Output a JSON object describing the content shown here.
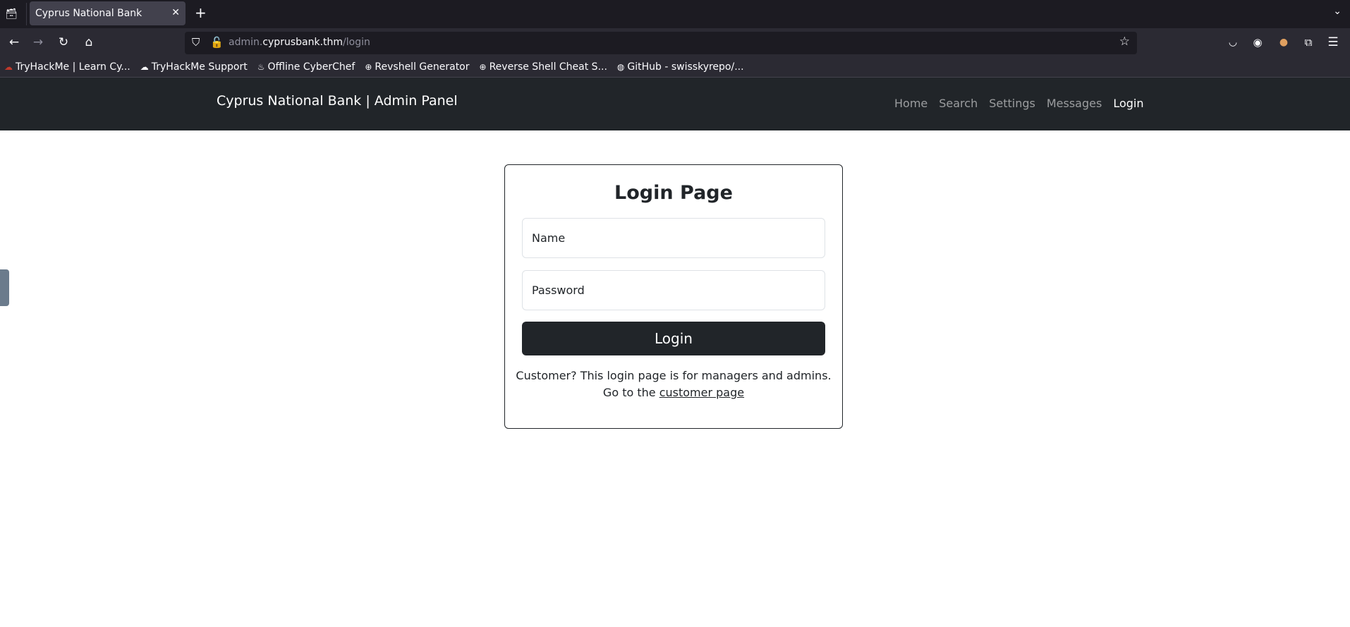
{
  "browser": {
    "tab_title": "Cyprus National Bank",
    "url_prefix": "admin.",
    "url_domain": "cyprusbank.thm",
    "url_path": "/login",
    "bookmarks": [
      {
        "label": "TryHackMe | Learn Cy...",
        "icon": "cloud-icon"
      },
      {
        "label": "TryHackMe Support",
        "icon": "cloud-icon"
      },
      {
        "label": "Offline CyberChef",
        "icon": "chef-icon"
      },
      {
        "label": "Revshell Generator",
        "icon": "globe-icon"
      },
      {
        "label": "Reverse Shell Cheat S...",
        "icon": "globe-icon"
      },
      {
        "label": "GitHub - swisskyrepo/...",
        "icon": "github-icon"
      }
    ]
  },
  "site": {
    "brand": "Cyprus National Bank | Admin Panel",
    "nav": [
      "Home",
      "Search",
      "Settings",
      "Messages",
      "Login"
    ],
    "active_nav": "Login"
  },
  "login": {
    "title": "Login Page",
    "name_placeholder": "Name",
    "password_placeholder": "Password",
    "button_label": "Login",
    "note_line1": "Customer? This login page is for managers and admins.",
    "note_line2_prefix": "Go to the ",
    "customer_link": "customer page"
  }
}
